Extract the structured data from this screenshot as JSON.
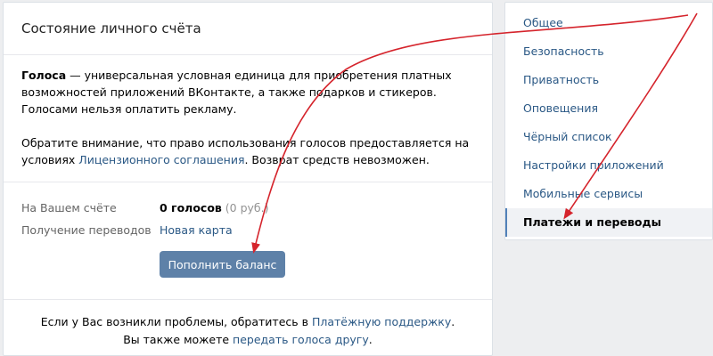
{
  "main": {
    "title": "Состояние личного счёта",
    "info": {
      "term": "Голоса",
      "definition": " — универсальная условная единица для приобретения платных возможностей приложений ВКонтакте, а также подарков и стикеров. Голосами нельзя оплатить рекламу.",
      "notice_prefix": "Обратите внимание, что право использования голосов предоставляется на условиях ",
      "license_link": "Лицензионного соглашения",
      "notice_suffix": ". Возврат средств невозможен."
    },
    "balance": {
      "account_label": "На Вашем счёте",
      "account_value": "0 голосов",
      "account_rub": " (0 руб.)",
      "transfer_label": "Получение переводов",
      "transfer_value": "Новая карта",
      "topup_button": "Пополнить баланс"
    },
    "footer": {
      "line1_prefix": "Если у Вас возникли проблемы, обратитесь в ",
      "support_link": "Платёжную поддержку",
      "line1_suffix": ".",
      "line2_prefix": "Вы также можете ",
      "transfer_link": "передать голоса другу",
      "line2_suffix": "."
    }
  },
  "sidebar": {
    "items": [
      {
        "label": "Общее"
      },
      {
        "label": "Безопасность"
      },
      {
        "label": "Приватность"
      },
      {
        "label": "Оповещения"
      },
      {
        "label": "Чёрный список"
      },
      {
        "label": "Настройки приложений"
      },
      {
        "label": "Мобильные сервисы"
      },
      {
        "label": "Платежи и переводы"
      }
    ]
  },
  "colors": {
    "accent": "#5e81a8",
    "link": "#2a5885",
    "annotation_arrow": "#d5242c"
  }
}
